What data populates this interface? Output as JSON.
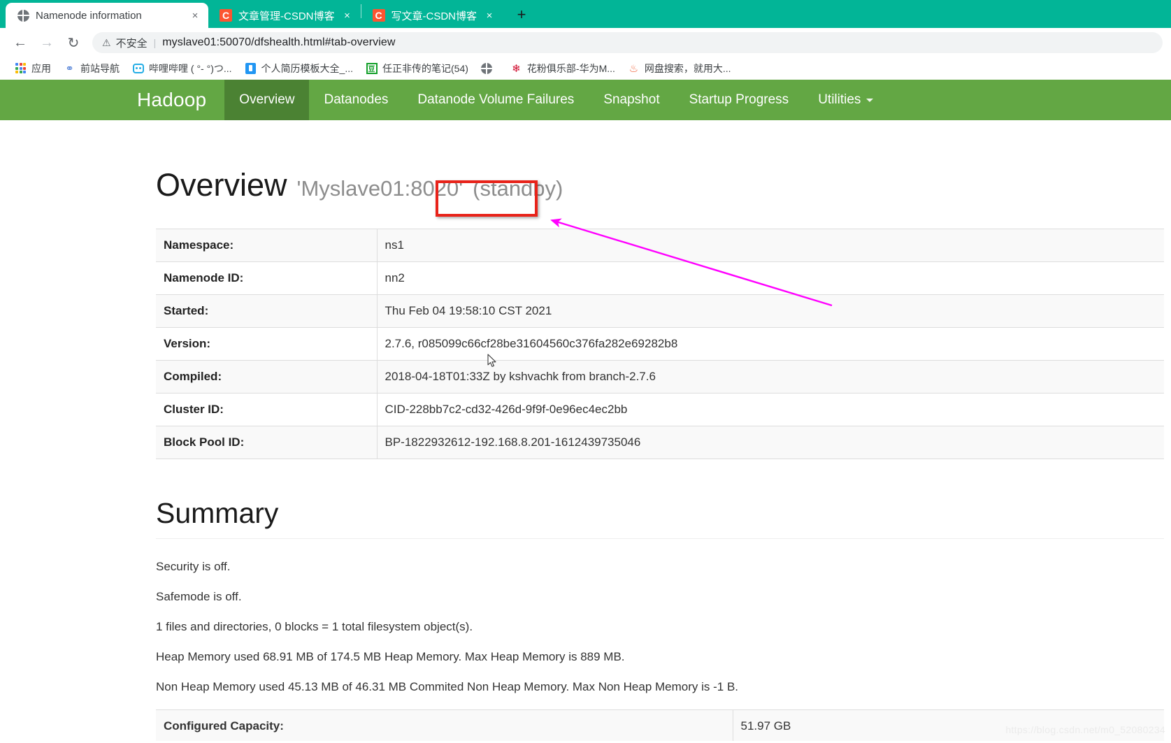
{
  "browser": {
    "tabs": [
      {
        "title": "Namenode information",
        "favicon": "globe-icon",
        "active": true,
        "close": "×"
      },
      {
        "title": "文章管理-CSDN博客",
        "favicon": "csdn-icon",
        "active": false,
        "close": "×"
      },
      {
        "title": "写文章-CSDN博客",
        "favicon": "csdn-icon",
        "active": false,
        "close": "×"
      }
    ],
    "new_tab_label": "+",
    "nav": {
      "back": "←",
      "forward": "→",
      "reload": "↻"
    },
    "omnibox": {
      "warning_icon": "⚠",
      "security_label": "不安全",
      "separator": "|",
      "url": "myslave01:50070/dfshealth.html#tab-overview"
    },
    "bookmarks": [
      {
        "label": "应用",
        "icon": "apps-grid-icon"
      },
      {
        "label": "前站导航",
        "icon": "planet-icon"
      },
      {
        "label": "哔哩哔哩 ( °- °)つ...",
        "icon": "bilibili-icon"
      },
      {
        "label": "个人简历模板大全_...",
        "icon": "document-icon"
      },
      {
        "label": "任正非传的笔记(54)",
        "icon": "douban-icon"
      },
      {
        "label": "",
        "icon": "globe-icon"
      },
      {
        "label": "花粉俱乐部-华为M...",
        "icon": "huawei-icon"
      },
      {
        "label": "网盘搜索，就用大...",
        "icon": "orange-icon"
      }
    ]
  },
  "hadoop": {
    "brand": "Hadoop",
    "nav_items": [
      {
        "label": "Overview",
        "active": true
      },
      {
        "label": "Datanodes",
        "active": false
      },
      {
        "label": "Datanode Volume Failures",
        "active": false
      },
      {
        "label": "Snapshot",
        "active": false
      },
      {
        "label": "Startup Progress",
        "active": false
      },
      {
        "label": "Utilities",
        "active": false,
        "dropdown": true
      }
    ]
  },
  "overview": {
    "heading": "Overview",
    "address": "'Myslave01:8020'",
    "state": "(standby)",
    "rows": [
      {
        "key": "Namespace:",
        "value": "ns1"
      },
      {
        "key": "Namenode ID:",
        "value": "nn2"
      },
      {
        "key": "Started:",
        "value": "Thu Feb 04 19:58:10 CST 2021"
      },
      {
        "key": "Version:",
        "value": "2.7.6, r085099c66cf28be31604560c376fa282e69282b8"
      },
      {
        "key": "Compiled:",
        "value": "2018-04-18T01:33Z by kshvachk from branch-2.7.6"
      },
      {
        "key": "Cluster ID:",
        "value": "CID-228bb7c2-cd32-426d-9f9f-0e96ec4ec2bb"
      },
      {
        "key": "Block Pool ID:",
        "value": "BP-1822932612-192.168.8.201-1612439735046"
      }
    ]
  },
  "summary": {
    "heading": "Summary",
    "lines": [
      "Security is off.",
      "Safemode is off.",
      "1 files and directories, 0 blocks = 1 total filesystem object(s).",
      "Heap Memory used 68.91 MB of 174.5 MB Heap Memory. Max Heap Memory is 889 MB.",
      "Non Heap Memory used 45.13 MB of 46.31 MB Commited Non Heap Memory. Max Non Heap Memory is -1 B."
    ],
    "capacity_rows": [
      {
        "key": "Configured Capacity:",
        "value": "51.97 GB"
      }
    ]
  },
  "annotations": {
    "highlight_color": "#e8231a",
    "arrow_color": "#ff00ff",
    "watermark": "https://blog.csdn.net/m0_52080234"
  }
}
